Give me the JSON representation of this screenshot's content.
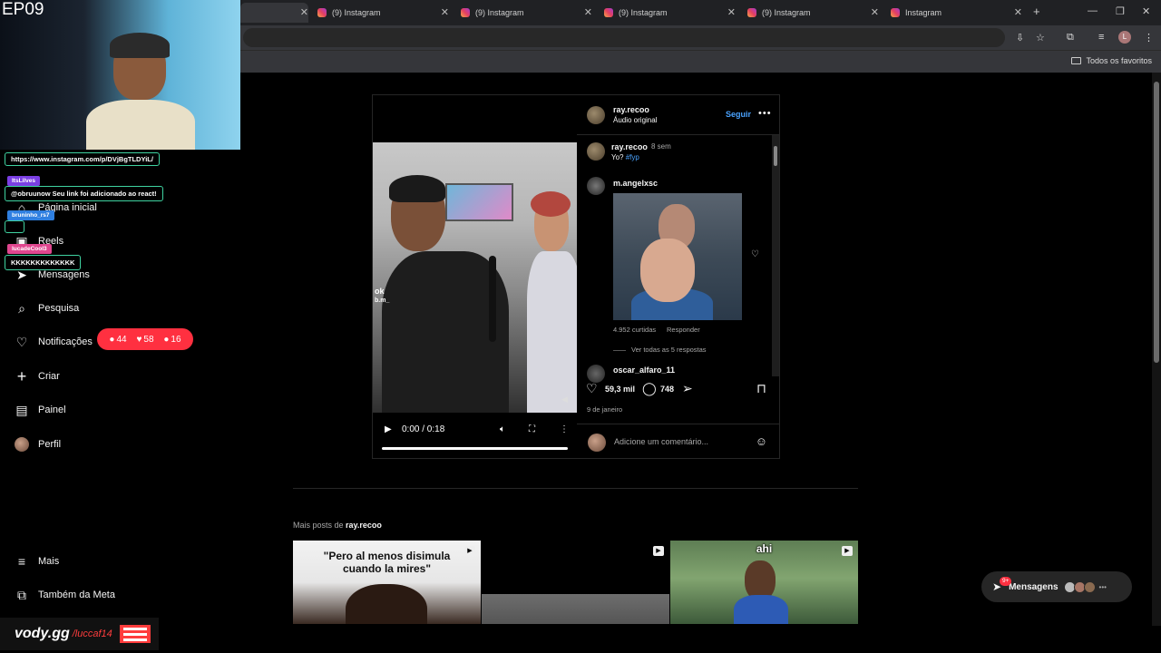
{
  "browser": {
    "tabs": [
      {
        "title": "(9) Instagram"
      },
      {
        "title": "(9) Instagram"
      },
      {
        "title": "(9) Instagram"
      },
      {
        "title": "(9) Instagram"
      },
      {
        "title": "Instagram"
      }
    ],
    "new_tab": "+",
    "bookmark_folder": "Todos os favoritos",
    "profile_initial": "L"
  },
  "stream": {
    "episode": "EP09",
    "chat_url": "https://www.instagram.com/p/DVjBgTLDYiL/",
    "chat": [
      {
        "user": "ItsLilves",
        "message": "@obruunow Seu link foi adicionado ao react!"
      },
      {
        "user": "bruninho_rs7",
        "message": ""
      },
      {
        "user": "lucadeCool3",
        "message": "KKKKKKKKKKKKK"
      }
    ],
    "branding": {
      "logo": "vody.gg",
      "handle": "/luccaf14"
    }
  },
  "nav": {
    "items": [
      {
        "label": "Página inicial",
        "icon": "home-icon"
      },
      {
        "label": "Reels",
        "icon": "reels-icon"
      },
      {
        "label": "Mensagens",
        "icon": "messages-icon"
      },
      {
        "label": "Pesquisa",
        "icon": "search-icon"
      },
      {
        "label": "Notificações",
        "icon": "heart-icon"
      },
      {
        "label": "Criar",
        "icon": "plus-icon"
      },
      {
        "label": "Painel",
        "icon": "dashboard-icon"
      },
      {
        "label": "Perfil",
        "icon": "avatar"
      }
    ],
    "more": "Mais",
    "meta": "Também da Meta",
    "notifications": {
      "comments": "44",
      "likes": "58",
      "follows": "16"
    }
  },
  "post": {
    "author": "ray.recoo",
    "audio": "Áudio original",
    "follow": "Seguir",
    "video": {
      "time": "0:00 / 0:18",
      "watermark_1": "ok",
      "watermark_2": "b.m_"
    },
    "caption": {
      "user": "ray.recoo",
      "age": "8 sem",
      "text": "Yo?",
      "hashtag": "#fyp"
    },
    "comments": [
      {
        "user": "m.angelxsc",
        "likes": "4.952 curtidas",
        "reply": "Responder",
        "view_replies": "Ver todas as 5 respostas"
      },
      {
        "user": "oscar_alfaro_11"
      }
    ],
    "like_count": "59,3 mil",
    "comment_count": "748",
    "date": "9 de janeiro",
    "comment_placeholder": "Adicione um comentário..."
  },
  "more_posts": {
    "prefix": "Mais posts de",
    "user": "ray.recoo",
    "thumbs": [
      {
        "caption": "\"Pero al menos disimula cuando la mires\""
      },
      {
        "caption": ""
      },
      {
        "caption": "ahi"
      }
    ]
  },
  "messages_pill": {
    "label": "Mensagens",
    "badge": "9+"
  },
  "colors": {
    "accent_blue": "#4aa3ff",
    "notif_red": "#ff3040",
    "chat_border": "#3fd2a0"
  }
}
